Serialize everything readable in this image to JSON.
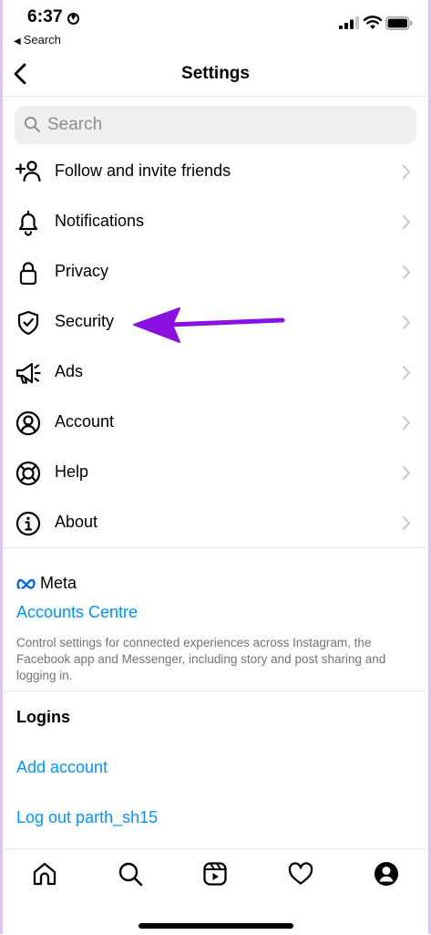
{
  "status_bar": {
    "time": "6:37",
    "back_app": "Search"
  },
  "header": {
    "title": "Settings"
  },
  "search": {
    "placeholder": "Search"
  },
  "settings_items": [
    {
      "label": "Follow and invite friends",
      "icon": "add-person-icon"
    },
    {
      "label": "Notifications",
      "icon": "bell-icon"
    },
    {
      "label": "Privacy",
      "icon": "lock-icon"
    },
    {
      "label": "Security",
      "icon": "shield-icon"
    },
    {
      "label": "Ads",
      "icon": "megaphone-icon"
    },
    {
      "label": "Account",
      "icon": "account-circle-icon"
    },
    {
      "label": "Help",
      "icon": "lifebuoy-icon"
    },
    {
      "label": "About",
      "icon": "info-icon"
    }
  ],
  "meta_section": {
    "brand": "Meta",
    "accounts_centre": "Accounts Centre",
    "description": "Control settings for connected experiences across Instagram, the Facebook app and Messenger, including story and post sharing and logging in."
  },
  "logins": {
    "heading": "Logins",
    "add_account": "Add account",
    "log_out": "Log out parth_sh15"
  },
  "tab_bar": [
    "home-icon",
    "search-icon",
    "reels-icon",
    "heart-icon",
    "profile-icon"
  ],
  "colors": {
    "link_blue": "#0095f6",
    "annotation_purple": "#8a11e0",
    "divider": "#e6e6e6"
  }
}
